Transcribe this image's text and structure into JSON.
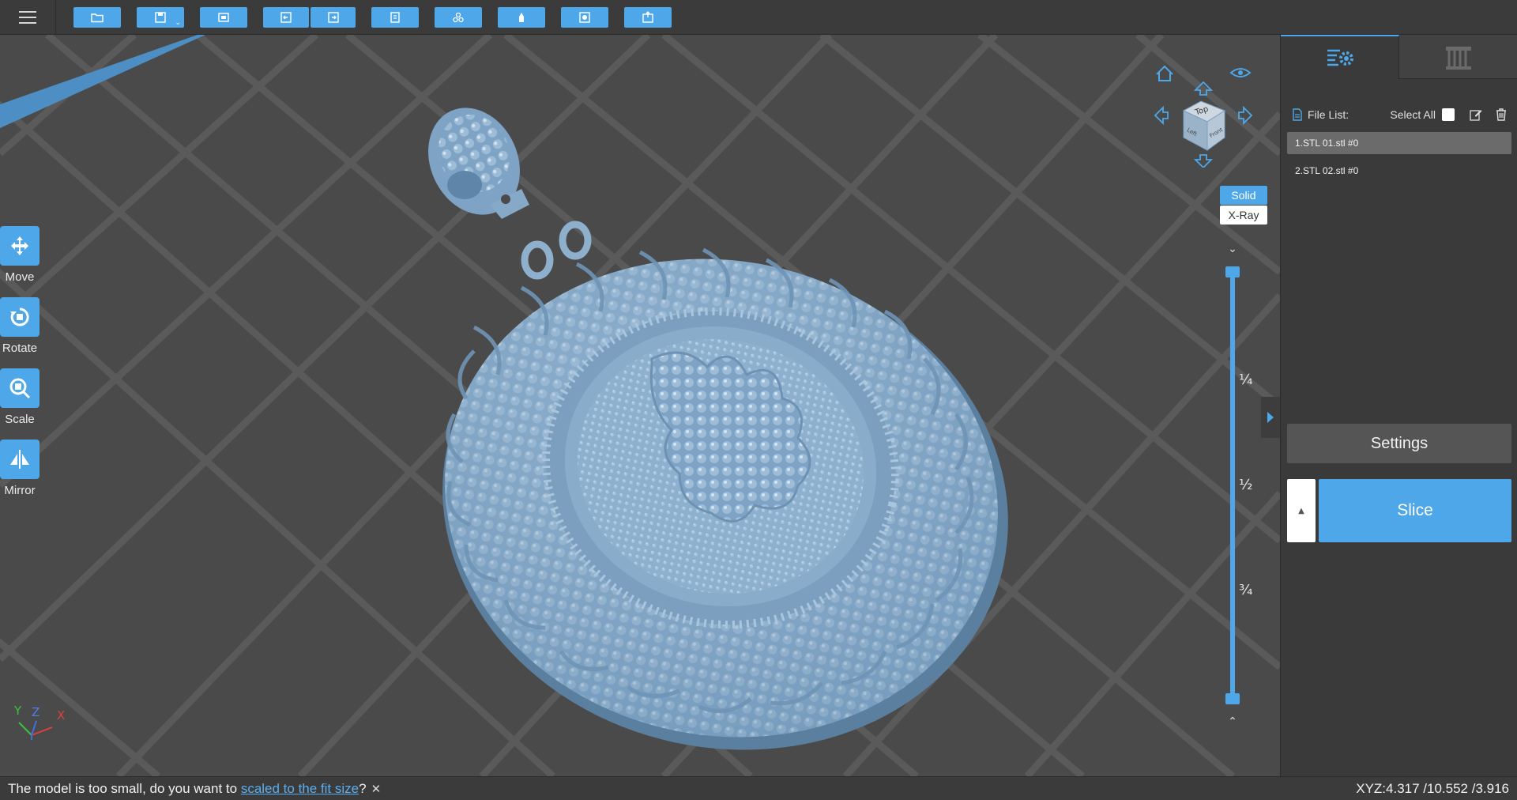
{
  "toolbar": {
    "menu_icon": "hamburger-menu-icon",
    "buttons": [
      "open-file-icon",
      "save-icon",
      "screenshot-icon",
      "undo-icon",
      "redo-icon",
      "copy-icon",
      "arrange-icon",
      "support-icon",
      "hollow-icon",
      "export-icon"
    ],
    "accent": "#4da7e8"
  },
  "tools": {
    "move": "Move",
    "rotate": "Rotate",
    "scale": "Scale",
    "mirror": "Mirror"
  },
  "view": {
    "solid": "Solid",
    "xray": "X-Ray",
    "cube_top": "Top",
    "cube_left": "Left",
    "cube_front": "Front"
  },
  "layer_slider": {
    "q1": "¼",
    "q2": "½",
    "q3": "¾"
  },
  "panel": {
    "file_list_label": "File List:",
    "select_all_label": "Select All",
    "files": [
      "1.STL 01.stl #0",
      "2.STL 02.stl #0"
    ],
    "settings_label": "Settings",
    "slice_label": "Slice"
  },
  "status": {
    "message_prefix": "The model is too small, do you want to ",
    "message_link": "scaled to the fit size",
    "message_suffix": "?",
    "close": "✕",
    "xyz": "XYZ:4.317 /10.552 /3.916"
  },
  "axis": {
    "x": "X",
    "y": "Y",
    "z": "Z"
  }
}
